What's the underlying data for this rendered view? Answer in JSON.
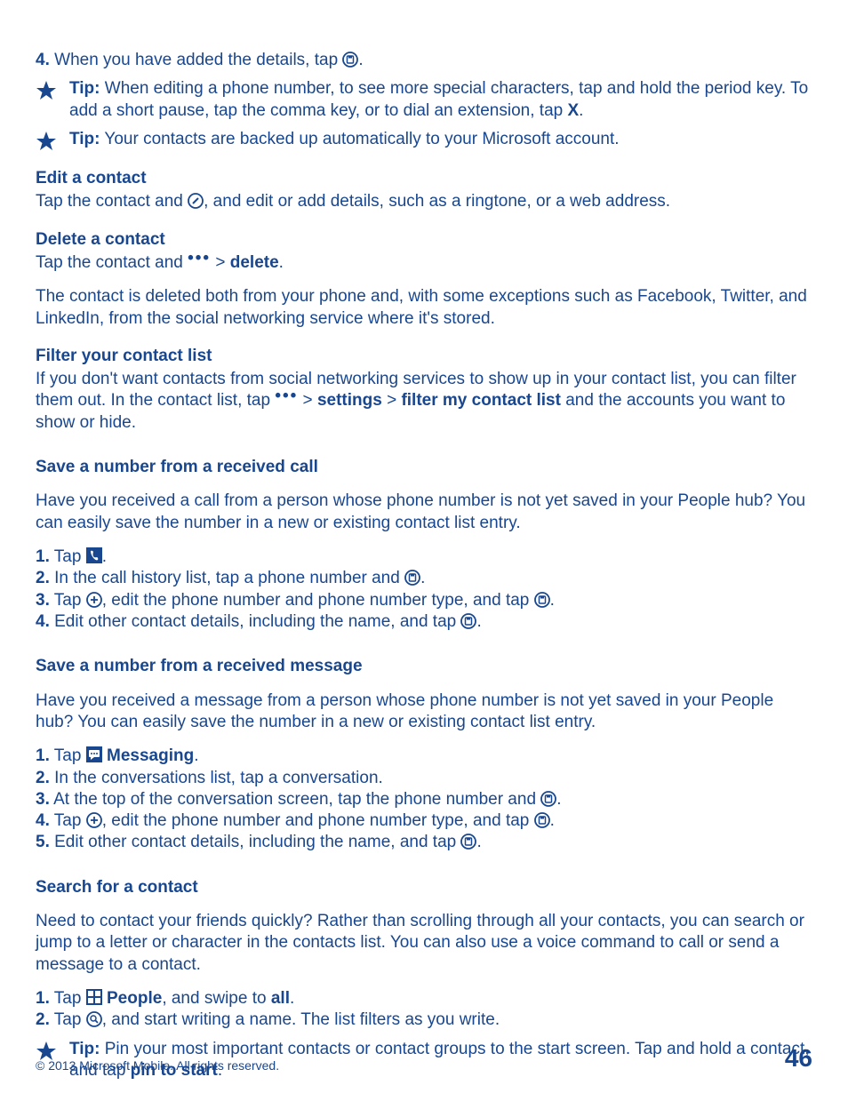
{
  "step4_intro": {
    "num": "4.",
    "text_a": " When you have added the details, tap ",
    "text_b": "."
  },
  "tip1": {
    "label": "Tip:",
    "body": " When editing a phone number, to see more special characters, tap and hold the period key. To add a short pause, tap the comma key, or to dial an extension, tap ",
    "x": "X",
    "tail": "."
  },
  "tip2": {
    "label": "Tip:",
    "body": " Your contacts are backed up automatically to your Microsoft account."
  },
  "edit": {
    "heading": "Edit a contact",
    "a": "Tap the contact and ",
    "b": ", and edit or add details, such as a ringtone, or a web address."
  },
  "delete": {
    "heading": "Delete a contact",
    "a": "Tap the contact and ",
    "gt": " > ",
    "action": "delete",
    "tail": ".",
    "para2": "The contact is deleted both from your phone and, with some exceptions such as Facebook, Twitter, and LinkedIn, from the social networking service where it's stored."
  },
  "filter": {
    "heading": "Filter your contact list",
    "a": "If you don't want contacts from social networking services to show up in your contact list, you can filter them out. In the contact list, tap ",
    "gt": " > ",
    "settings": "settings",
    "gt2": " > ",
    "fml": "filter my contact list",
    "tail": " and the accounts you want to show or hide."
  },
  "save_call": {
    "heading": "Save a number from a received call",
    "intro": "Have you received a call from a person whose phone number is not yet saved in your People hub? You can easily save the number in a new or existing contact list entry.",
    "s1": {
      "num": "1.",
      "a": " Tap ",
      "b": "."
    },
    "s2": {
      "num": "2.",
      "a": " In the call history list, tap a phone number and ",
      "b": "."
    },
    "s3": {
      "num": "3.",
      "a": " Tap ",
      "b": ", edit the phone number and phone number type, and tap ",
      "c": "."
    },
    "s4": {
      "num": "4.",
      "a": " Edit other contact details, including the name, and tap ",
      "b": "."
    }
  },
  "save_msg": {
    "heading": "Save a number from a received message",
    "intro": "Have you received a message from a person whose phone number is not yet saved in your People hub? You can easily save the number in a new or existing contact list entry.",
    "s1": {
      "num": "1.",
      "a": " Tap ",
      "app": "Messaging",
      "b": "."
    },
    "s2": {
      "num": "2.",
      "a": " In the conversations list, tap a conversation."
    },
    "s3": {
      "num": "3.",
      "a": " At the top of the conversation screen, tap the phone number and ",
      "b": "."
    },
    "s4": {
      "num": "4.",
      "a": " Tap ",
      "b": ", edit the phone number and phone number type, and tap ",
      "c": "."
    },
    "s5": {
      "num": "5.",
      "a": " Edit other contact details, including the name, and tap ",
      "b": "."
    }
  },
  "search": {
    "heading": "Search for a contact",
    "intro": "Need to contact your friends quickly? Rather than scrolling through all your contacts, you can search or jump to a letter or character in the contacts list. You can also use a voice command to call or send a message to a contact.",
    "s1": {
      "num": "1.",
      "a": " Tap ",
      "app": "People",
      "b": ", and swipe to ",
      "all": "all",
      "c": "."
    },
    "s2": {
      "num": "2.",
      "a": " Tap ",
      "b": ", and start writing a name. The list filters as you write."
    },
    "tip": {
      "label": "Tip:",
      "a": " Pin your most important contacts or contact groups to the start screen. Tap and hold a contact, and tap ",
      "pin": "pin to start",
      "b": "."
    }
  },
  "footer": {
    "copyright": "© 2013 Microsoft Mobile. All rights reserved.",
    "page": "46"
  }
}
